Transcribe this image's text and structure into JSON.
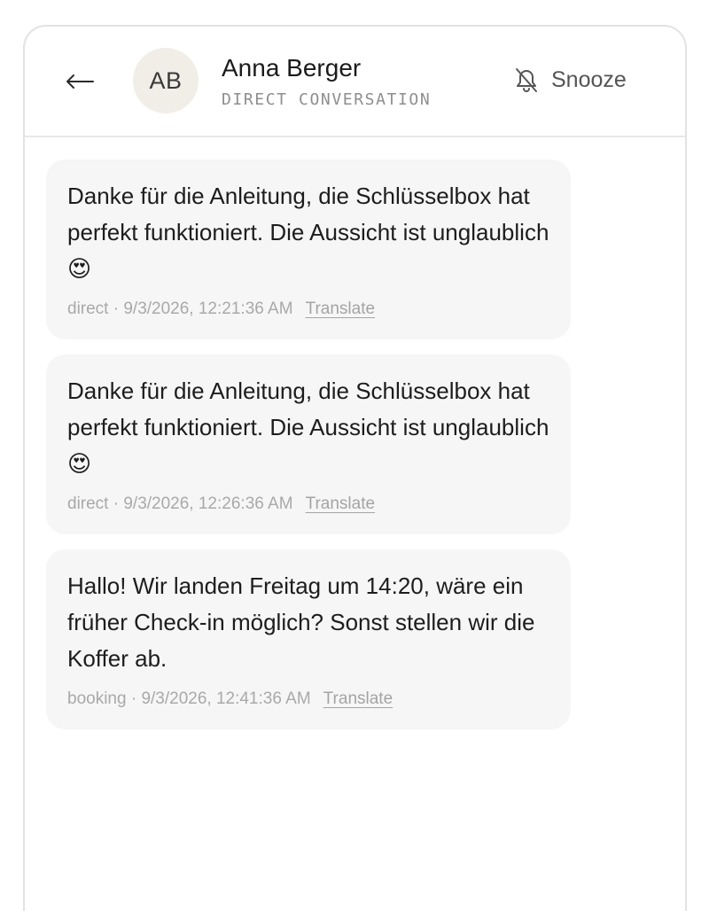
{
  "header": {
    "back_icon": "arrow-left-icon",
    "avatar_initials": "AB",
    "contact_name": "Anna Berger",
    "subtitle": "DIRECT CONVERSATION",
    "snooze_icon": "bell-off-icon",
    "snooze_label": "Snooze"
  },
  "messages": [
    {
      "text": "Danke für die Anleitung, die Schlüsselbox hat perfekt funktioniert. Die Aussicht ist unglaublich 😍",
      "meta": "direct · 9/3/2026, 12:21:36 AM",
      "translate_label": "Translate"
    },
    {
      "text": "Danke für die Anleitung, die Schlüsselbox hat perfekt funktioniert. Die Aussicht ist unglaublich 😍",
      "meta": "direct · 9/3/2026, 12:26:36 AM",
      "translate_label": "Translate"
    },
    {
      "text": "Hallo! Wir landen Freitag um 14:20, wäre ein früher Check-in möglich? Sonst stellen wir die Koffer ab.",
      "meta": "booking · 9/3/2026, 12:41:36 AM",
      "translate_label": "Translate"
    }
  ],
  "colors": {
    "bubble_bg": "#f6f6f6",
    "avatar_bg": "#f1eee8",
    "border": "#e3e3e3"
  }
}
